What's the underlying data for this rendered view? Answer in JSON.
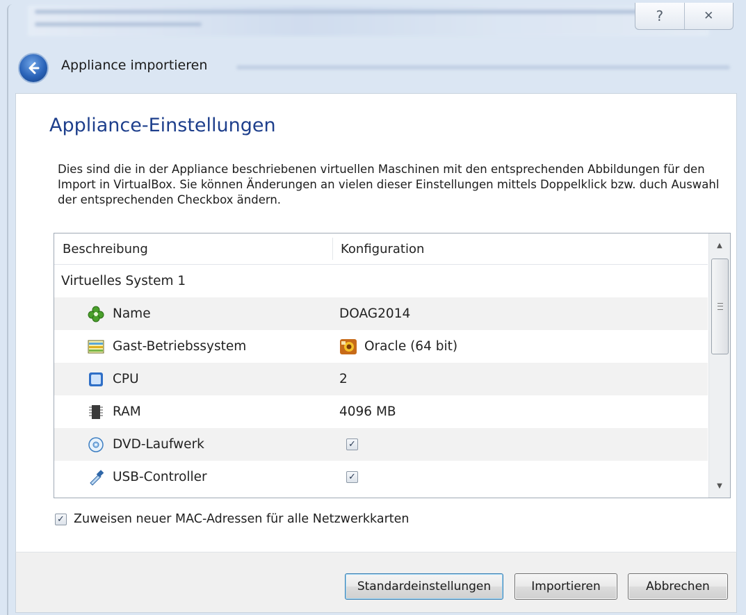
{
  "window": {
    "help_glyph": "?",
    "close_glyph": "✕"
  },
  "header": {
    "title": "Appliance importieren"
  },
  "section": {
    "title": "Appliance-Einstellungen",
    "description": "Dies sind die in der Appliance beschriebenen virtuellen Maschinen mit den entsprechenden Abbildungen für den Import in VirtualBox. Sie können Änderungen an vielen dieser Einstellungen mittels Doppelklick bzw. duch Auswahl der entsprechenden Checkbox ändern."
  },
  "table": {
    "columns": [
      "Beschreibung",
      "Konfiguration"
    ],
    "group": "Virtuelles System 1",
    "rows": [
      {
        "label": "Name",
        "icon": "name-icon",
        "value": "DOAG2014"
      },
      {
        "label": "Gast-Betriebssystem",
        "icon": "guest-os-icon",
        "value": "Oracle (64 bit)",
        "value_icon": "oracle-os-icon"
      },
      {
        "label": "CPU",
        "icon": "cpu-icon",
        "value": "2"
      },
      {
        "label": "RAM",
        "icon": "ram-icon",
        "value": "4096 MB"
      },
      {
        "label": "DVD-Laufwerk",
        "icon": "dvd-icon",
        "checked": true
      },
      {
        "label": "USB-Controller",
        "icon": "usb-icon",
        "checked": true
      }
    ]
  },
  "mac_option": {
    "label": "Zuweisen neuer MAC-Adressen für alle Netzwerkkarten",
    "checked": true
  },
  "buttons": {
    "defaults": "Standardeinstellungen",
    "import": "Importieren",
    "cancel": "Abbrechen"
  },
  "colors": {
    "title_blue": "#1e3f8c",
    "frame": "#dbe6f3"
  }
}
